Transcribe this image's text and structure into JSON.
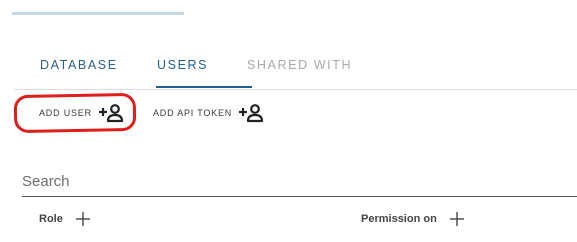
{
  "tabs": [
    {
      "label": "DATABASE"
    },
    {
      "label": "USERS"
    },
    {
      "label": "SHARED WITH"
    }
  ],
  "active_tab": "USERS",
  "actions": {
    "add_user_label": "ADD USER",
    "add_api_token_label": "ADD API TOKEN"
  },
  "search": {
    "placeholder": "Search",
    "value": ""
  },
  "columns": {
    "role_label": "Role",
    "permission_label": "Permission on"
  },
  "icons": {
    "add_user": "person-add-icon",
    "add_api_token": "person-add-icon",
    "add_role": "plus-icon",
    "add_permission": "plus-icon"
  },
  "colors": {
    "accent": "#1e5f92",
    "inactive_tab": "#a9a9a9",
    "annotation": "#e01e1e"
  }
}
